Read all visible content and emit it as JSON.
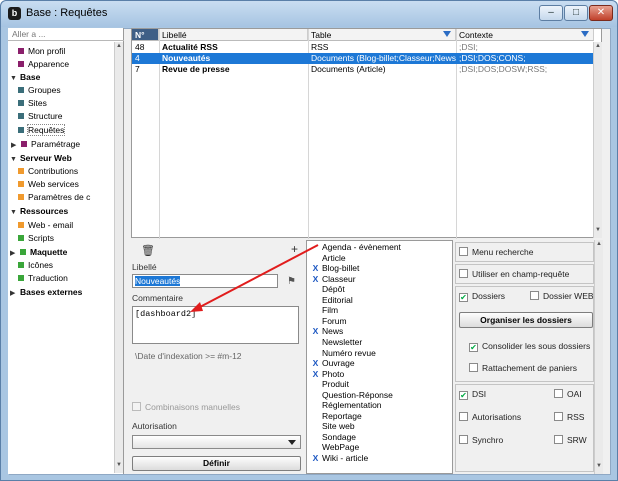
{
  "window": {
    "title": "Base : Requêtes",
    "app_icon_glyph": "b",
    "minimize_glyph": "–",
    "maximize_glyph": "□",
    "close_glyph": "✕"
  },
  "sidebar": {
    "goto_placeholder": "Aller a ...",
    "items": [
      {
        "label": "Mon profil",
        "color": "#8a1f6b"
      },
      {
        "label": "Apparence",
        "color": "#8a1f6b"
      },
      {
        "label": "Base",
        "bold": true
      },
      {
        "label": "Groupes",
        "color": "#3b6e7a"
      },
      {
        "label": "Sites",
        "color": "#3b6e7a"
      },
      {
        "label": "Structure",
        "color": "#3b6e7a"
      },
      {
        "label": "Requêtes",
        "color": "#3b6e7a",
        "selected": true
      },
      {
        "label": "Paramétrage",
        "color": "#8a1f6b"
      },
      {
        "label": "Serveur Web",
        "bold": true
      },
      {
        "label": "Contributions",
        "color": "#f09a2e"
      },
      {
        "label": "Web services",
        "color": "#f09a2e"
      },
      {
        "label": "Paramètres de c",
        "color": "#f09a2e"
      },
      {
        "label": "Ressources",
        "bold": true
      },
      {
        "label": "Web - email",
        "color": "#f09a2e"
      },
      {
        "label": "Scripts",
        "color": "#3aa63a"
      },
      {
        "label": "Maquette",
        "color": "#3aa63a",
        "bold": true
      },
      {
        "label": "Icônes",
        "color": "#3aa63a"
      },
      {
        "label": "Traduction",
        "color": "#3aa63a"
      },
      {
        "label": "Bases externes",
        "bold": true
      }
    ]
  },
  "table": {
    "columns": [
      "N°",
      "Libellé",
      "Table",
      "Contexte"
    ],
    "rows": [
      {
        "num": "48",
        "libelle": "Actualité RSS",
        "table": "RSS",
        "contexte": ";DSI;"
      },
      {
        "num": "4",
        "libelle": "Nouveautés",
        "table": "Documents (Blog-billet;Classeur;News;C",
        "contexte": ";DSI;DOS;CONS;",
        "selected": true
      },
      {
        "num": "7",
        "libelle": "Revue de presse",
        "table": "Documents (Article)",
        "contexte": ";DSI;DOS;DOSW;RSS;"
      }
    ]
  },
  "form": {
    "trash_glyph": "🗑",
    "plus_glyph": "+",
    "flag_glyph": "⚑",
    "libelle_label": "Libellé",
    "libelle_value": "Nouveautés",
    "commentaire_label": "Commentaire",
    "commentaire_value": "[dashboard2]",
    "date_hint": "\\Date d'indexation >= #m-12",
    "combinaisons_label": "Combinaisons manuelles",
    "autorisation_label": "Autorisation",
    "autorisation_value": "",
    "definir_label": "Définir"
  },
  "doc_types": [
    {
      "label": "Agenda - évènement",
      "checked": false
    },
    {
      "label": "Article",
      "checked": false
    },
    {
      "label": "Blog-billet",
      "checked": true
    },
    {
      "label": "Classeur",
      "checked": true
    },
    {
      "label": "Dépôt",
      "checked": false
    },
    {
      "label": "Editorial",
      "checked": false
    },
    {
      "label": "Film",
      "checked": false
    },
    {
      "label": "Forum",
      "checked": false
    },
    {
      "label": "News",
      "checked": true
    },
    {
      "label": "Newsletter",
      "checked": false
    },
    {
      "label": "Numéro revue",
      "checked": false
    },
    {
      "label": "Ouvrage",
      "checked": true
    },
    {
      "label": "Photo",
      "checked": true
    },
    {
      "label": "Produit",
      "checked": false
    },
    {
      "label": "Question-Réponse",
      "checked": false
    },
    {
      "label": "Réglementation",
      "checked": false
    },
    {
      "label": "Reportage",
      "checked": false
    },
    {
      "label": "Site web",
      "checked": false
    },
    {
      "label": "Sondage",
      "checked": false
    },
    {
      "label": "WebPage",
      "checked": false
    },
    {
      "label": "Wiki - article",
      "checked": true
    }
  ],
  "doc_type_mark": "X",
  "options": {
    "menu_recherche": "Menu recherche",
    "utiliser_champ": "Utiliser en champ-requête",
    "dossiers": "Dossiers",
    "dossier_web": "Dossier WEB",
    "organiser": "Organiser les dossiers",
    "consolider": "Consolider les sous dossiers",
    "rattachement": "Rattachement de paniers",
    "dsi": "DSI",
    "oai": "OAI",
    "autorisations": "Autorisations",
    "rss": "RSS",
    "synchro": "Synchro",
    "srw": "SRW",
    "check_mark": "✔"
  }
}
